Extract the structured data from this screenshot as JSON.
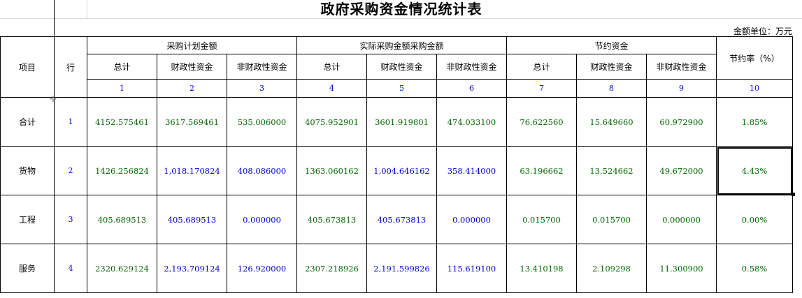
{
  "title": "政府采购资金情况统计表",
  "unit": "金额单位：万元",
  "headers": {
    "item": "项目",
    "row": "行",
    "group1": "采购计划金额",
    "group2": "实际采购金额采购金额",
    "group3": "节约资金",
    "rate": "节约率（%）",
    "sub": [
      "总计",
      "财政性资金",
      "非财政性资金",
      "总计",
      "财政性资金",
      "非财政性资金",
      "总计",
      "财政性资金",
      "非财政性资金"
    ],
    "numbers": [
      "1",
      "2",
      "3",
      "4",
      "5",
      "6",
      "7",
      "8",
      "9",
      "10"
    ]
  },
  "rows": [
    {
      "name": "合计",
      "line": "1",
      "values": [
        "4152.575461",
        "3617.569461",
        "535.006000",
        "4075.952901",
        "3601.919801",
        "474.033100",
        "76.622560",
        "15.649660",
        "60.972900",
        "1.85%"
      ]
    },
    {
      "name": "货物",
      "line": "2",
      "values": [
        "1426.256824",
        "1,018.170824",
        "408.086000",
        "1363.060162",
        "1,004.646162",
        "358.414000",
        "63.196662",
        "13.524662",
        "49.672000",
        "4.43%"
      ]
    },
    {
      "name": "工程",
      "line": "3",
      "values": [
        "405.689513",
        "405.689513",
        "0.000000",
        "405.673813",
        "405.673813",
        "0.000000",
        "0.015700",
        "0.015700",
        "0.000000",
        "0.00%"
      ]
    },
    {
      "name": "服务",
      "line": "4",
      "values": [
        "2320.629124",
        "2,193.709124",
        "126.920000",
        "2307.218926",
        "2,191.599826",
        "115.619100",
        "13.410198",
        "2.109298",
        "11.300900",
        "0.58%"
      ]
    }
  ],
  "colors": {
    "green": "#006600",
    "blue": "#0000cc"
  }
}
